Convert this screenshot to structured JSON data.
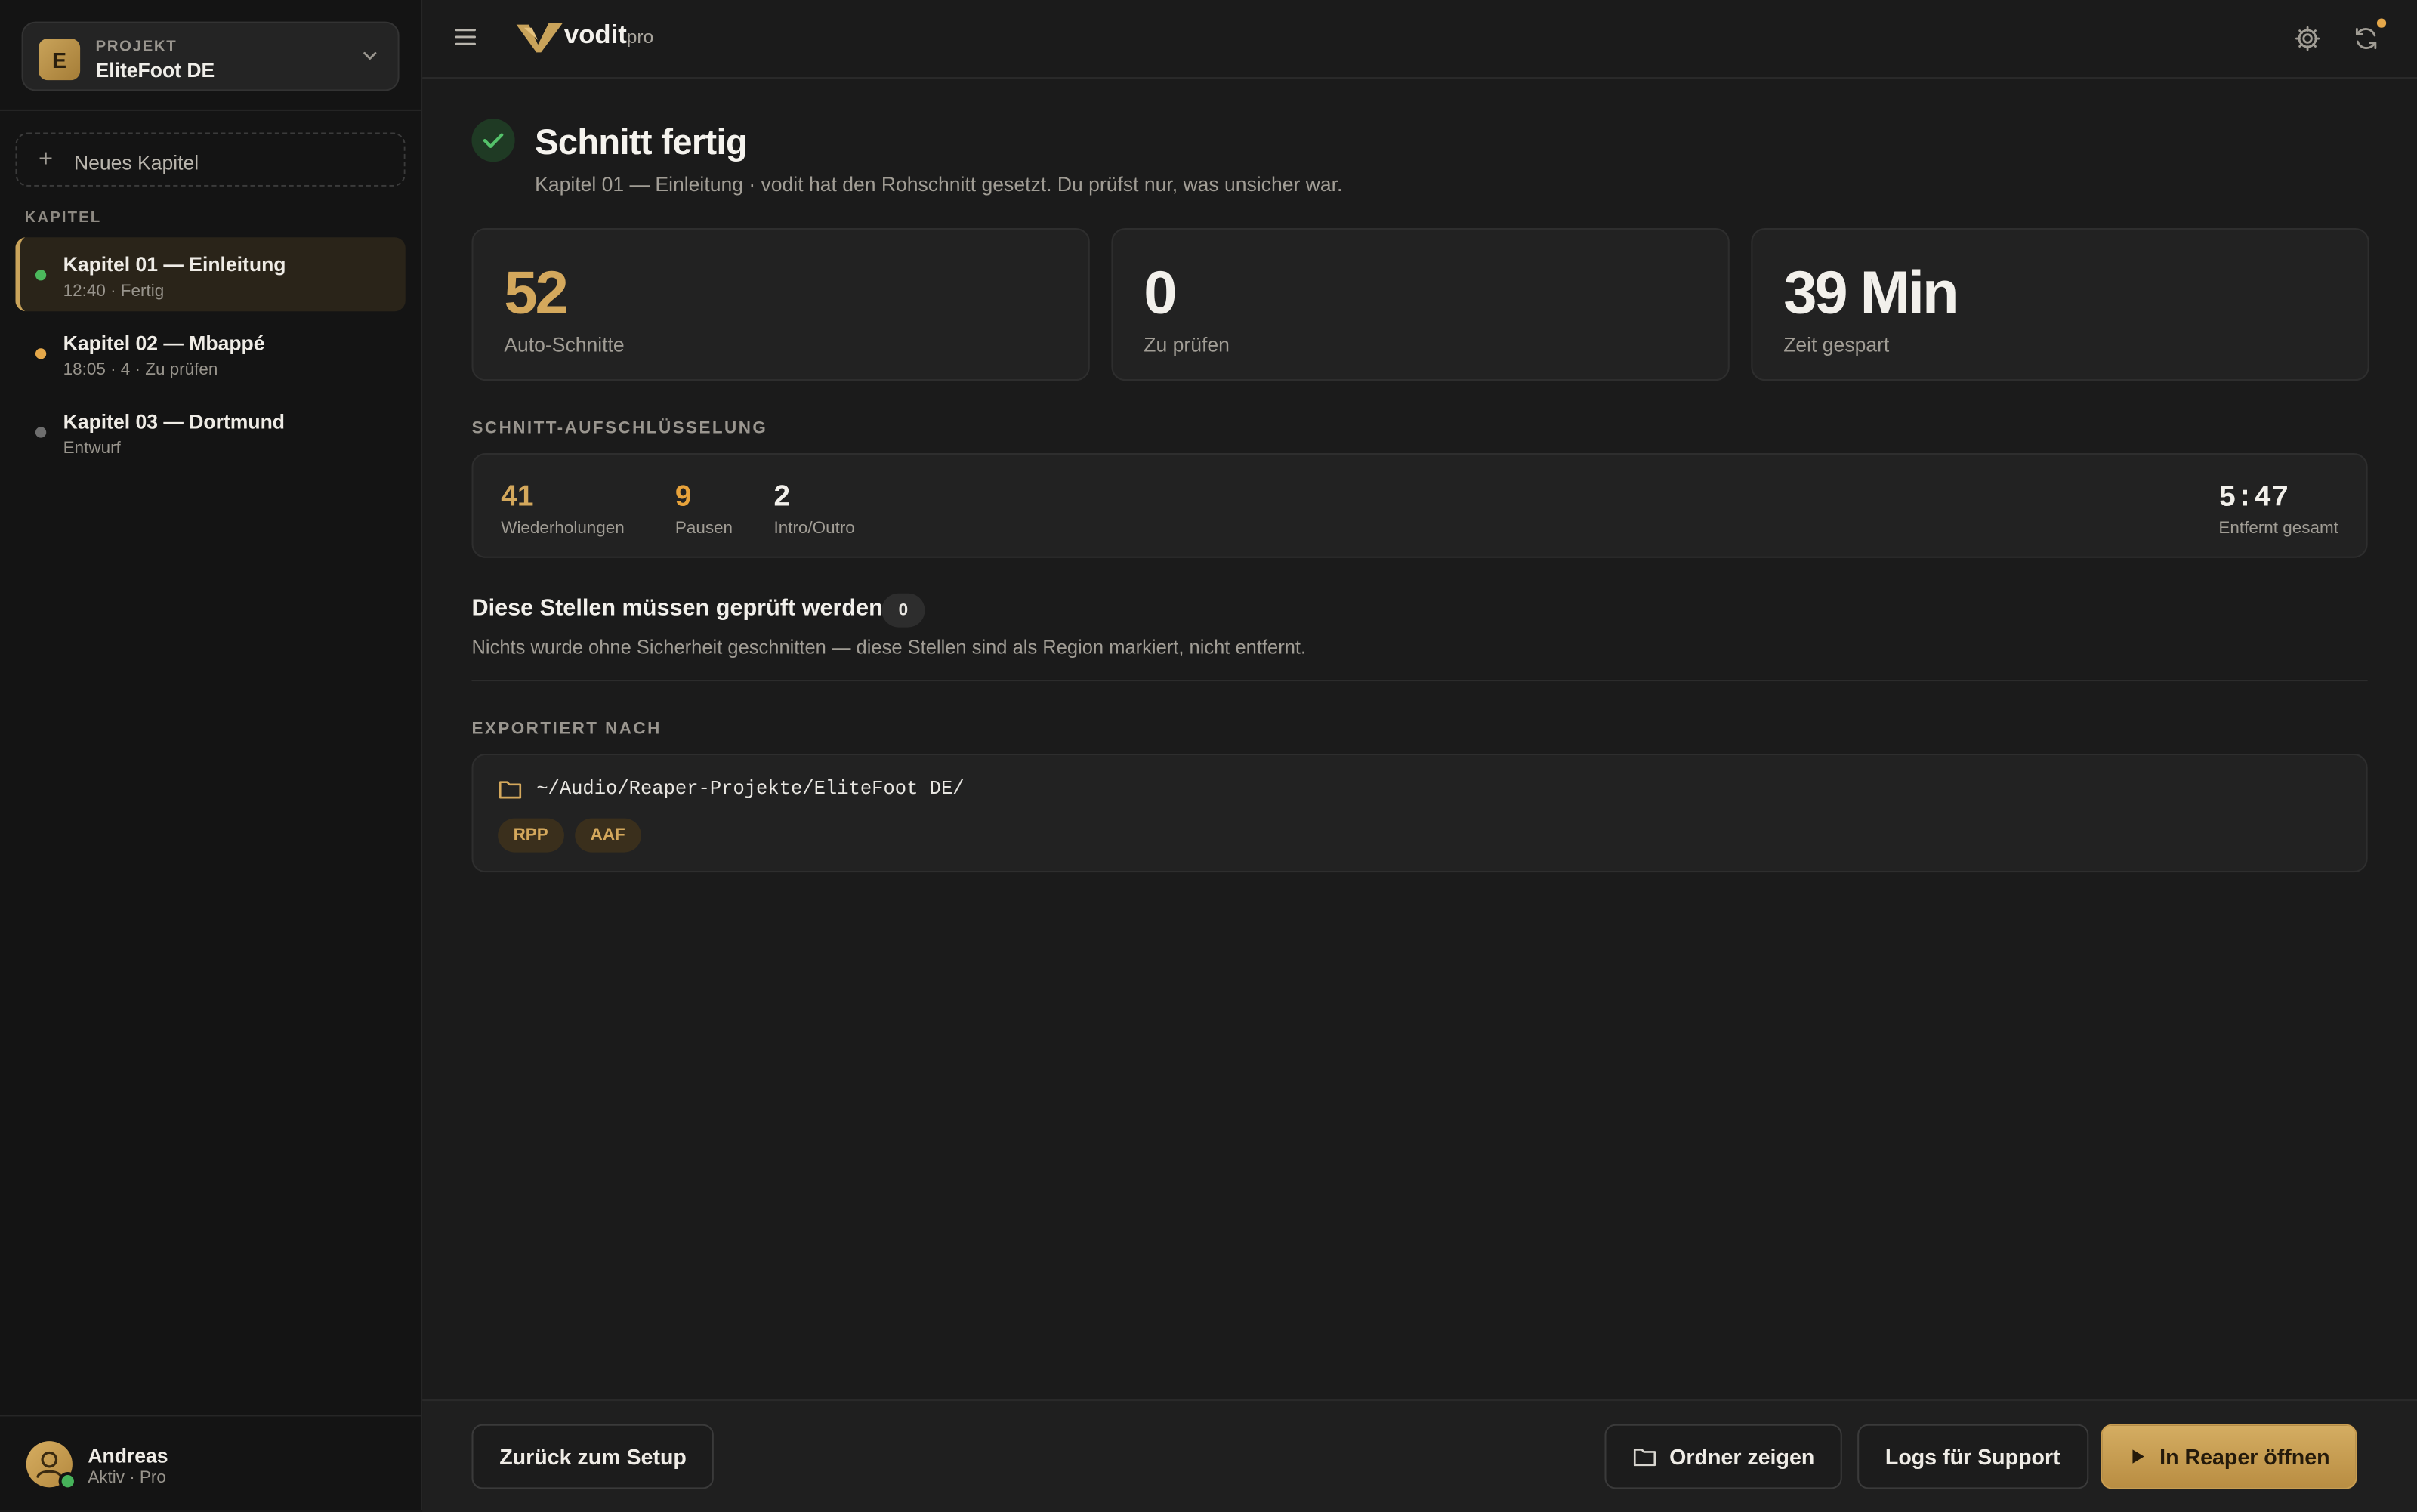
{
  "project": {
    "kicker": "PROJEKT",
    "name": "EliteFoot DE",
    "initial": "E"
  },
  "sidebar": {
    "new_chapter": "Neues Kapitel",
    "section_label": "KAPITEL",
    "chapters": [
      {
        "title": "Kapitel 01 — Einleitung",
        "meta": "12:40 · Fertig",
        "status_color": "#4bb85c"
      },
      {
        "title": "Kapitel 02 — Mbappé",
        "meta": "18:05 · 4 · Zu prüfen",
        "status_color": "#e5a84a"
      },
      {
        "title": "Kapitel 03 — Dortmund",
        "meta": "Entwurf",
        "status_color": "#6e6e6e"
      }
    ],
    "user": {
      "name": "Andreas",
      "meta": "Aktiv · Pro"
    }
  },
  "topbar": {
    "logo": "vodit",
    "logo_suffix": "pro"
  },
  "header": {
    "title": "Schnitt fertig",
    "subtitle": "Kapitel 01 — Einleitung · vodit hat den Rohschnitt gesetzt. Du prüfst nur, was unsicher war."
  },
  "stats": [
    {
      "value": "52",
      "label": "Auto-Schnitte"
    },
    {
      "value": "0",
      "label": "Zu prüfen"
    },
    {
      "value": "39 Min",
      "label": "Zeit gespart"
    }
  ],
  "breakdown": {
    "label": "SCHNITT-AUFSCHLÜSSELUNG",
    "items": [
      {
        "value": "41",
        "label": "Wiederholungen",
        "color": "#d4a85c"
      },
      {
        "value": "9",
        "label": "Pausen",
        "color": "#e8a33b"
      },
      {
        "value": "2",
        "label": "Intro/Outro",
        "color": "#f2f0eb"
      }
    ],
    "total_value": "5:47",
    "total_label": "Entfernt gesamt"
  },
  "review": {
    "title": "Diese Stellen müssen geprüft werden",
    "count": "0",
    "note": "Nichts wurde ohne Sicherheit geschnitten — diese Stellen sind als Region markiert, nicht entfernt."
  },
  "export": {
    "label": "EXPORTIERT NACH",
    "path": "~/Audio/Reaper-Projekte/EliteFoot DE/",
    "formats": [
      "RPP",
      "AAF"
    ]
  },
  "footer": {
    "back": "Zurück zum Setup",
    "show_folder": "Ordner zeigen",
    "logs": "Logs für Support",
    "open_reaper": "In Reaper öffnen"
  },
  "colors": {
    "accent": "#d4a85c",
    "background": "#1b1b1b",
    "sidebar": "#141414"
  }
}
